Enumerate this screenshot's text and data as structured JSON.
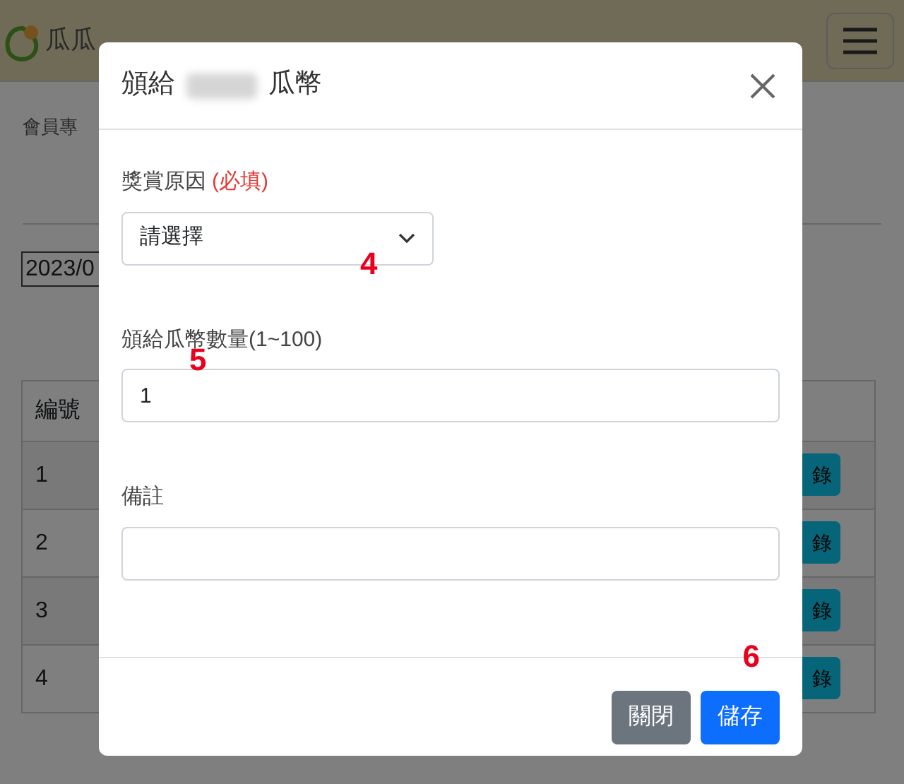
{
  "page": {
    "logo_text": "瓜瓜",
    "breadcrumb": "會員專",
    "date_value": "2023/0",
    "table": {
      "columns": [
        "編號"
      ],
      "rows": [
        {
          "cells": [
            "1"
          ],
          "action": "錄"
        },
        {
          "cells": [
            "2"
          ],
          "action": "錄"
        },
        {
          "cells": [
            "3"
          ],
          "action": "錄"
        },
        {
          "cells": [
            "4"
          ],
          "action": "錄"
        }
      ]
    }
  },
  "dialog": {
    "title_before": "頒給",
    "title_after": "瓜幣",
    "fields": [
      {
        "kind": "select",
        "label": "獎賞原因",
        "required_note": "(必填)",
        "value": "請選擇",
        "annotation": "4"
      },
      {
        "kind": "input",
        "label": "頒給瓜幣數量(1~100)",
        "value": "1",
        "annotation": "5"
      },
      {
        "kind": "input",
        "label": "備註"
      }
    ],
    "footer_annotation": "6",
    "buttons": [
      {
        "label": "關閉",
        "kind": "secondary"
      },
      {
        "label": "儲存",
        "kind": "primary"
      }
    ]
  }
}
